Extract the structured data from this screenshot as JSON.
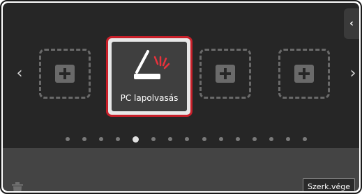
{
  "selected_tile": {
    "label": "PC lapolvasás",
    "icon": "scanner-icon"
  },
  "empty_slots": [
    {
      "icon": "add-icon"
    },
    {
      "icon": "add-icon"
    },
    {
      "icon": "add-icon"
    }
  ],
  "navigation": {
    "prev_icon": "chevron-left-icon",
    "next_icon": "chevron-right-icon",
    "collapse_icon": "chevron-left-icon"
  },
  "pagination": {
    "total_pages": 15,
    "current_page": 5
  },
  "footer": {
    "done_label": "Szerk.vége",
    "trash_icon": "trash-icon"
  },
  "colors": {
    "accent": "#c8202a",
    "background": "#262626",
    "panel": "#444444"
  }
}
